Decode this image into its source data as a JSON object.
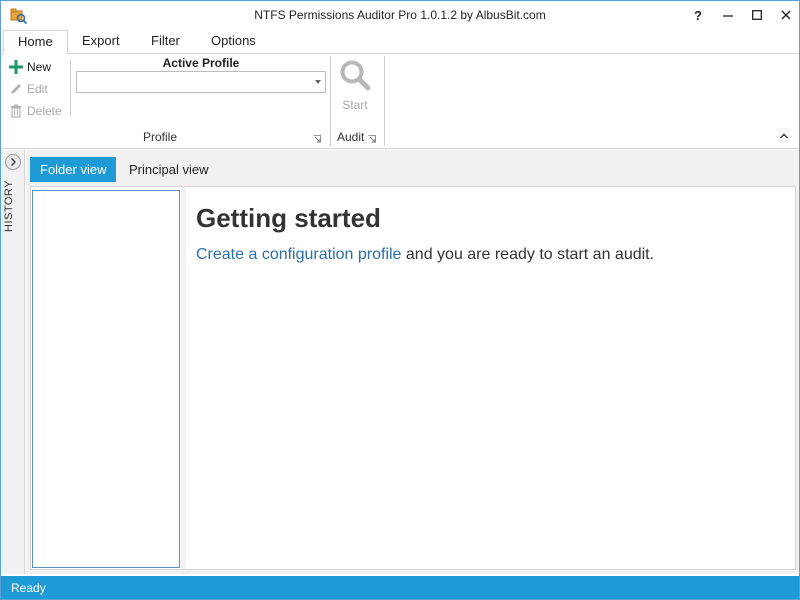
{
  "window": {
    "title": "NTFS Permissions Auditor Pro 1.0.1.2 by AlbusBit.com",
    "controls": {
      "help": "?",
      "minimize": "minimize",
      "maximize": "maximize",
      "close": "close"
    }
  },
  "ribbon": {
    "tabs": [
      {
        "label": "Home",
        "active": true
      },
      {
        "label": "Export",
        "active": false
      },
      {
        "label": "Filter",
        "active": false
      },
      {
        "label": "Options",
        "active": false
      }
    ],
    "profile_group": {
      "new_label": "New",
      "edit_label": "Edit",
      "delete_label": "Delete",
      "active_profile_label": "Active Profile",
      "active_profile_value": "",
      "group_label": "Profile"
    },
    "audit_group": {
      "start_label": "Start",
      "group_label": "Audit"
    }
  },
  "history": {
    "label": "HISTORY"
  },
  "views": {
    "tabs": [
      {
        "label": "Folder view",
        "active": true
      },
      {
        "label": "Principal view",
        "active": false
      }
    ]
  },
  "getting_started": {
    "title": "Getting started",
    "link_text": "Create a configuration profile",
    "rest_text": " and you are ready to start an audit."
  },
  "status": {
    "text": "Ready"
  },
  "colors": {
    "accent": "#1e9bd7",
    "link": "#2a6fa8",
    "new_icon": "#1a9a6a"
  }
}
